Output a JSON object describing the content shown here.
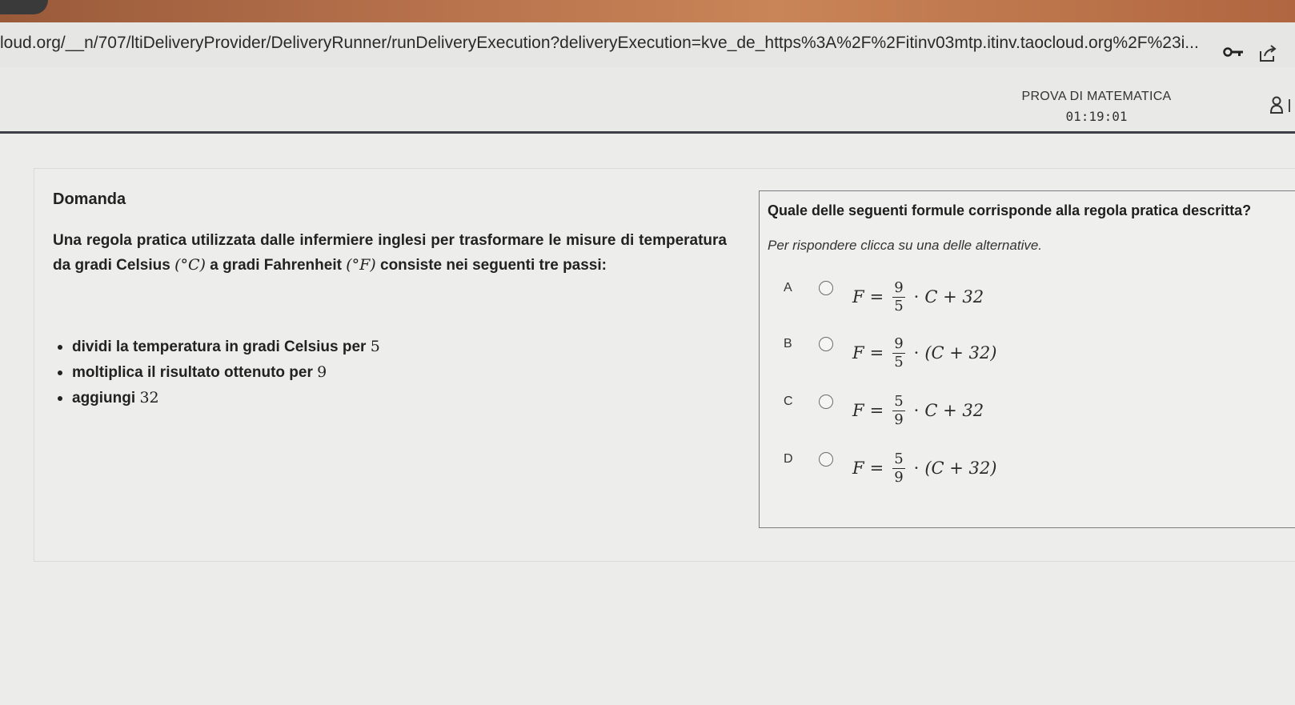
{
  "browser": {
    "url": "loud.org/__n/707/ltiDeliveryProvider/DeliveryRunner/runDeliveryExecution?deliveryExecution=kve_de_https%3A%2F%2Fitinv03mtp.itinv.taocloud.org%2F%23i..."
  },
  "test": {
    "title": "PROVA DI MATEMATICA",
    "timer": "01:19:01"
  },
  "question": {
    "heading": "Domanda",
    "stimulus_part1": "Una regola pratica utilizzata dalle infermiere inglesi per trasformare le misure di temperatura da gradi Celsius",
    "celsius_symbol": "(°C)",
    "stimulus_part2": "a gradi Fahrenheit",
    "fahrenheit_symbol": "(°F)",
    "stimulus_part3": "consiste nei seguenti tre passi:",
    "steps": [
      {
        "text": "dividi la temperatura in gradi Celsius per",
        "num": "5"
      },
      {
        "text": "moltiplica il risultato ottenuto per",
        "num": "9"
      },
      {
        "text": "aggiungi",
        "num": "32"
      }
    ]
  },
  "interaction": {
    "prompt": "Quale delle seguenti formule corrisponde alla regola pratica descritta?",
    "instruction": "Per rispondere clicca su una delle alternative.",
    "choices": [
      {
        "letter": "A",
        "lhs": "F",
        "eq": "=",
        "num": "9",
        "den": "5",
        "dot": "·",
        "rhs": "C + 32"
      },
      {
        "letter": "B",
        "lhs": "F",
        "eq": "=",
        "num": "9",
        "den": "5",
        "dot": "·",
        "rhs": "(C + 32)"
      },
      {
        "letter": "C",
        "lhs": "F",
        "eq": "=",
        "num": "5",
        "den": "9",
        "dot": "·",
        "rhs": "C + 32"
      },
      {
        "letter": "D",
        "lhs": "F",
        "eq": "=",
        "num": "5",
        "den": "9",
        "dot": "·",
        "rhs": "(C + 32)"
      }
    ]
  },
  "icons": {
    "key": "key-icon",
    "share": "share-icon",
    "user": "user-icon"
  }
}
